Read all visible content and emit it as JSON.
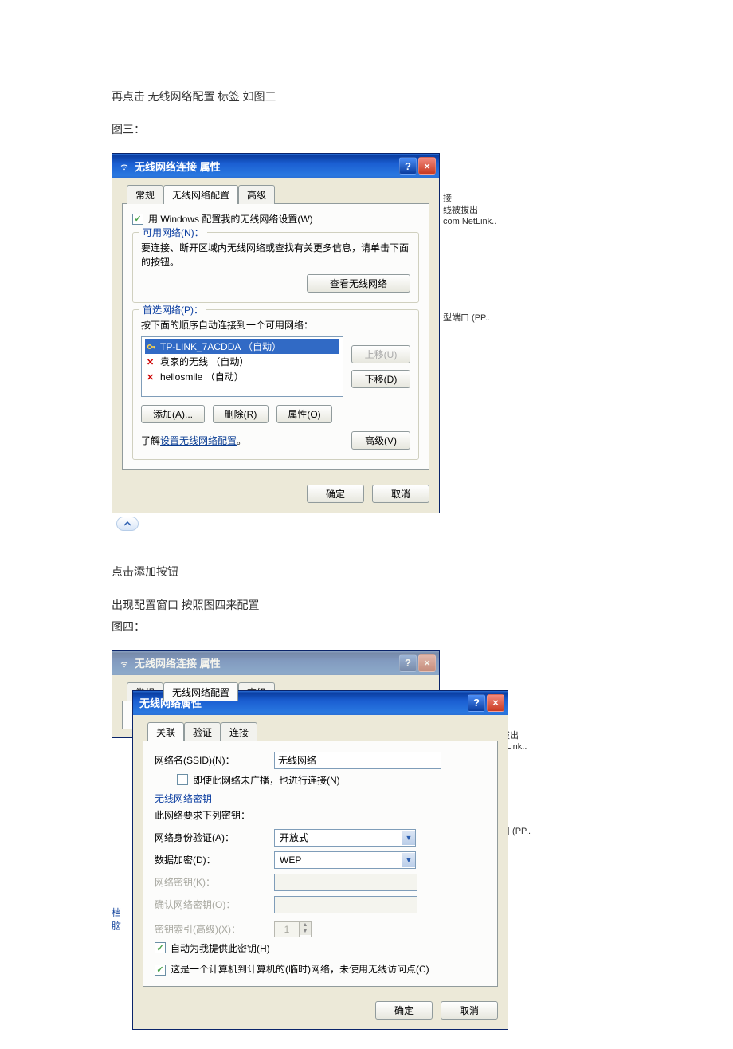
{
  "doc": {
    "p1": "再点击 无线网络配置 标签 如图三",
    "p2": "图三：",
    "p3": "点击添加按钮",
    "p4": "出现配置窗口 按照图四来配置",
    "p5": "图四："
  },
  "fig3": {
    "title": "无线网络连接 属性",
    "tabs": {
      "general": "常规",
      "wireless": "无线网络配置",
      "advanced": "高级"
    },
    "chk_use_windows": "用 Windows 配置我的无线网络设置(W)",
    "group_available": {
      "legend": "可用网络(N)：",
      "desc": "要连接、断开区域内无线网络或查找有关更多信息，请单击下面的按钮。",
      "view_btn": "查看无线网络"
    },
    "group_preferred": {
      "legend": "首选网络(P)：",
      "desc": "按下面的顺序自动连接到一个可用网络：",
      "items": [
        "TP-LINK_7ACDDA （自动）",
        "袁家的无线 （自动）",
        "hellosmile （自动）"
      ],
      "move_up": "上移(U)",
      "move_down": "下移(D)",
      "add": "添加(A)...",
      "remove": "删除(R)",
      "props": "属性(O)"
    },
    "learn_prefix": "了解",
    "learn_link": "设置无线网络配置",
    "learn_suffix": "。",
    "advanced_btn": "高级(V)",
    "ok": "确定",
    "cancel": "取消",
    "behind": {
      "l1": "接",
      "l2": "线被拔出",
      "l3": "com NetLink..",
      "l4": "型端口  (PP.."
    }
  },
  "fig4": {
    "parent": {
      "title": "无线网络连接 属性",
      "tabs": {
        "general": "常规",
        "wireless": "无线网络配置",
        "advanced": "高级"
      }
    },
    "child": {
      "title": "无线网络属性",
      "tabs": {
        "assoc": "关联",
        "auth": "验证",
        "conn": "连接"
      },
      "ssid_label": "网络名(SSID)(N)：",
      "ssid_value": "无线网络",
      "chk_nobroadcast": "即使此网络未广播，也进行连接(N)",
      "sect_key_title": "无线网络密钥",
      "sect_key_desc": "此网络要求下列密钥：",
      "auth_label": "网络身份验证(A)：",
      "auth_value": "开放式",
      "enc_label": "数据加密(D)：",
      "enc_value": "WEP",
      "key_label": "网络密钥(K)：",
      "key2_label": "确认网络密钥(O)：",
      "keyidx_label": "密钥索引(高级)(X)：",
      "keyidx_value": "1",
      "chk_autokey": "自动为我提供此密钥(H)",
      "chk_adhoc": "这是一个计算机到计算机的(临时)网络，未使用无线访问点(C)",
      "ok": "确定",
      "cancel": "取消"
    },
    "behind": {
      "l1": "被拔出",
      "l2": "NetLink..",
      "l3": "端口  (PP.."
    },
    "side": {
      "a": "档",
      "b": "脑"
    }
  }
}
